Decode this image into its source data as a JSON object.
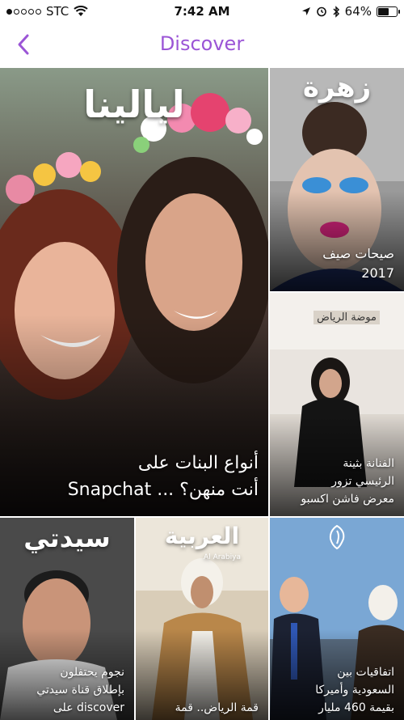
{
  "status_bar": {
    "carrier": "STC",
    "time": "7:42 AM",
    "battery_percent": "64%",
    "battery_level": 0.64,
    "signal_bars": 1,
    "icons": [
      "wifi-icon",
      "location-icon",
      "alarm-icon",
      "bluetooth-icon",
      "battery-icon"
    ]
  },
  "nav": {
    "back_icon": "chevron-left-icon",
    "title": "Discover",
    "accent_color": "#9b55d6"
  },
  "tiles": [
    {
      "publisher_logo": "ليالينا",
      "caption": [
        "أنواع البنات على",
        "Snapchat ... أنت منهن؟"
      ]
    },
    {
      "publisher_logo": "زهرة",
      "caption": [
        "صيحات صيف",
        "2017"
      ]
    },
    {
      "publisher_logo": "موضة الرياض",
      "caption": [
        "الفنانة بثينة",
        "الرئيسي تزور",
        "معرض فاشن اكسبو"
      ]
    },
    {
      "publisher_logo": "سيدتي",
      "caption": [
        "نجوم يحتفلون",
        "بإطلاق قناة سيدتي",
        "على discover"
      ]
    },
    {
      "publisher_logo": "العربية",
      "publisher_sublogo": "Al Arabiya",
      "caption": [
        "قمة الرياض.. قمة"
      ]
    },
    {
      "publisher_logo": "الجزيرة",
      "caption": [
        "اتفاقيات بين",
        "السعودية وأميركا",
        "بقيمة 460 مليار"
      ]
    }
  ]
}
